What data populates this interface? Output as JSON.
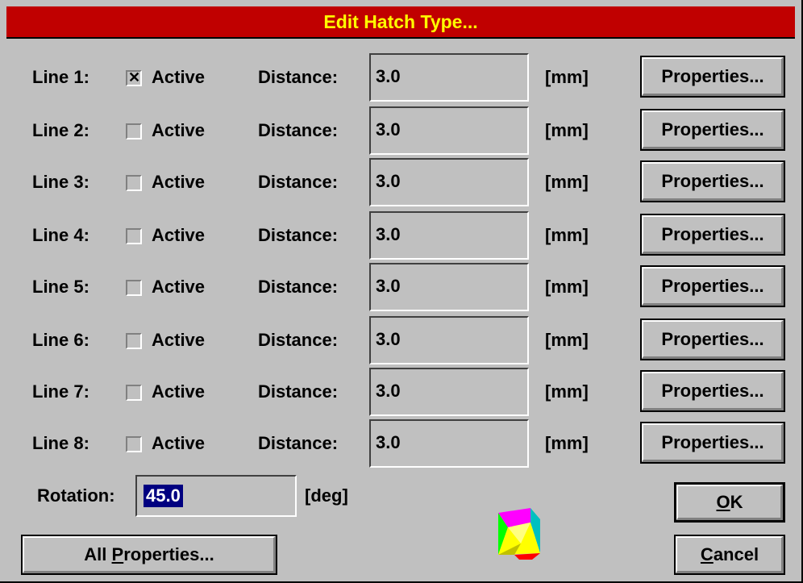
{
  "title": "Edit Hatch Type...",
  "distance_label": "Distance:",
  "unit_mm": "[mm]",
  "properties_label": "Properties...",
  "active_label": "Active",
  "lines": [
    {
      "label": "Line 1:",
      "active": true,
      "distance": "3.0"
    },
    {
      "label": "Line 2:",
      "active": false,
      "distance": "3.0"
    },
    {
      "label": "Line 3:",
      "active": false,
      "distance": "3.0"
    },
    {
      "label": "Line 4:",
      "active": false,
      "distance": "3.0"
    },
    {
      "label": "Line 5:",
      "active": false,
      "distance": "3.0"
    },
    {
      "label": "Line 6:",
      "active": false,
      "distance": "3.0"
    },
    {
      "label": "Line 7:",
      "active": false,
      "distance": "3.0"
    },
    {
      "label": "Line 8:",
      "active": false,
      "distance": "3.0"
    }
  ],
  "rotation": {
    "label": "Rotation:",
    "value": "45.0",
    "unit": "[deg]"
  },
  "buttons": {
    "all_properties_pre": "All ",
    "all_properties_ul": "P",
    "all_properties_post": "roperties...",
    "ok_ul": "O",
    "ok_post": "K",
    "cancel_ul": "C",
    "cancel_post": "ancel"
  },
  "colors": {
    "title_bg": "#c00000",
    "title_fg": "#ffff00",
    "dialog_bg": "#c0c0c0",
    "selection": "#000080"
  },
  "icons": {
    "app_icon": "hatch-cube-icon"
  }
}
